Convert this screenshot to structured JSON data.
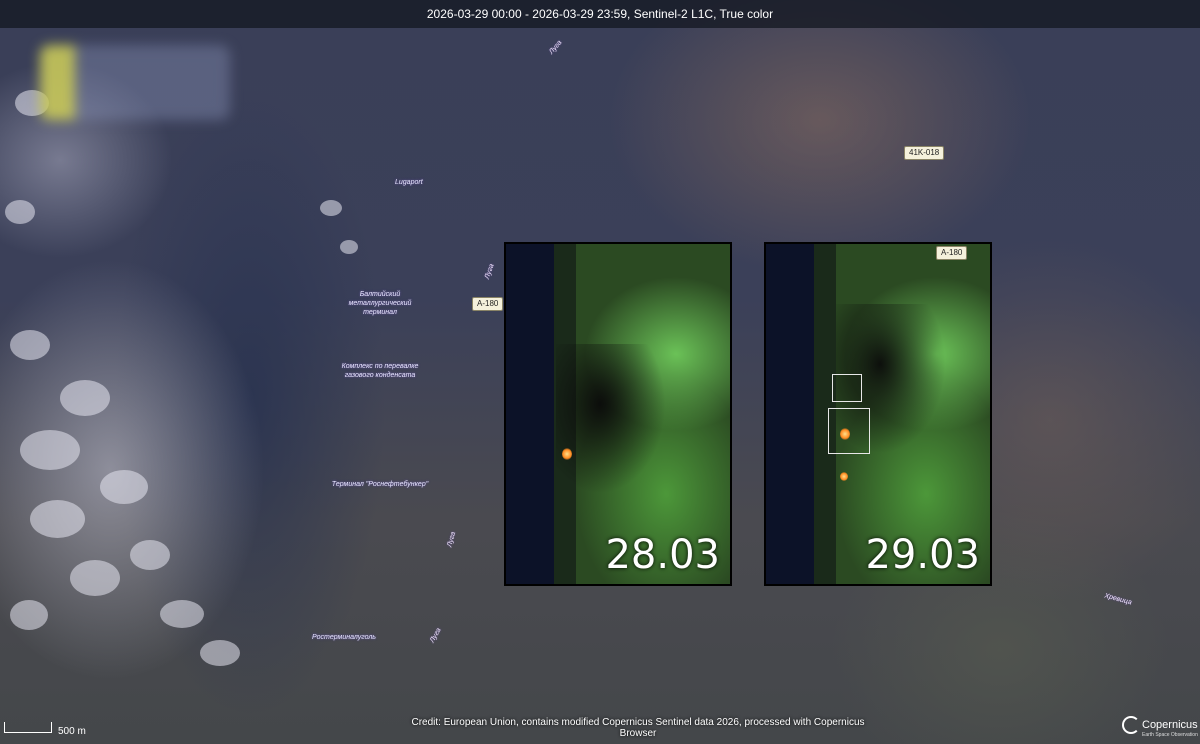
{
  "header": {
    "title": "2026-03-29 00:00 - 2026-03-29 23:59, Sentinel-2 L1C, True color"
  },
  "map_labels": {
    "lugaport": "Lugaport",
    "terminal_1": "Балтийский металлургический терминал",
    "terminal_2": "Комплекс по перевалке газового конденсата",
    "terminal_3": "Терминал \"Роснефтебункер\"",
    "port_west": "Ростерминалуголь",
    "river_1": "Луга",
    "river_2": "Луга",
    "river_3": "Луга",
    "river_4": "Луга",
    "river_5": "Хревица"
  },
  "road_shields": {
    "a180_left": "A-180",
    "a180_right": "A-180",
    "k018": "41K-018"
  },
  "panels": [
    {
      "date": "28.03"
    },
    {
      "date": "29.03"
    }
  ],
  "footer": {
    "scale_label": "500 m",
    "credit": "Credit: European Union, contains modified Copernicus Sentinel data 2026, processed with Copernicus Browser",
    "brand": "Copernicus",
    "brand_sub": "Earth Space Observation"
  },
  "colors": {
    "topbar_bg": "#14182299",
    "vegetation": "#6ec85a",
    "water": "#0c1228",
    "fire": "#ff8a20"
  }
}
